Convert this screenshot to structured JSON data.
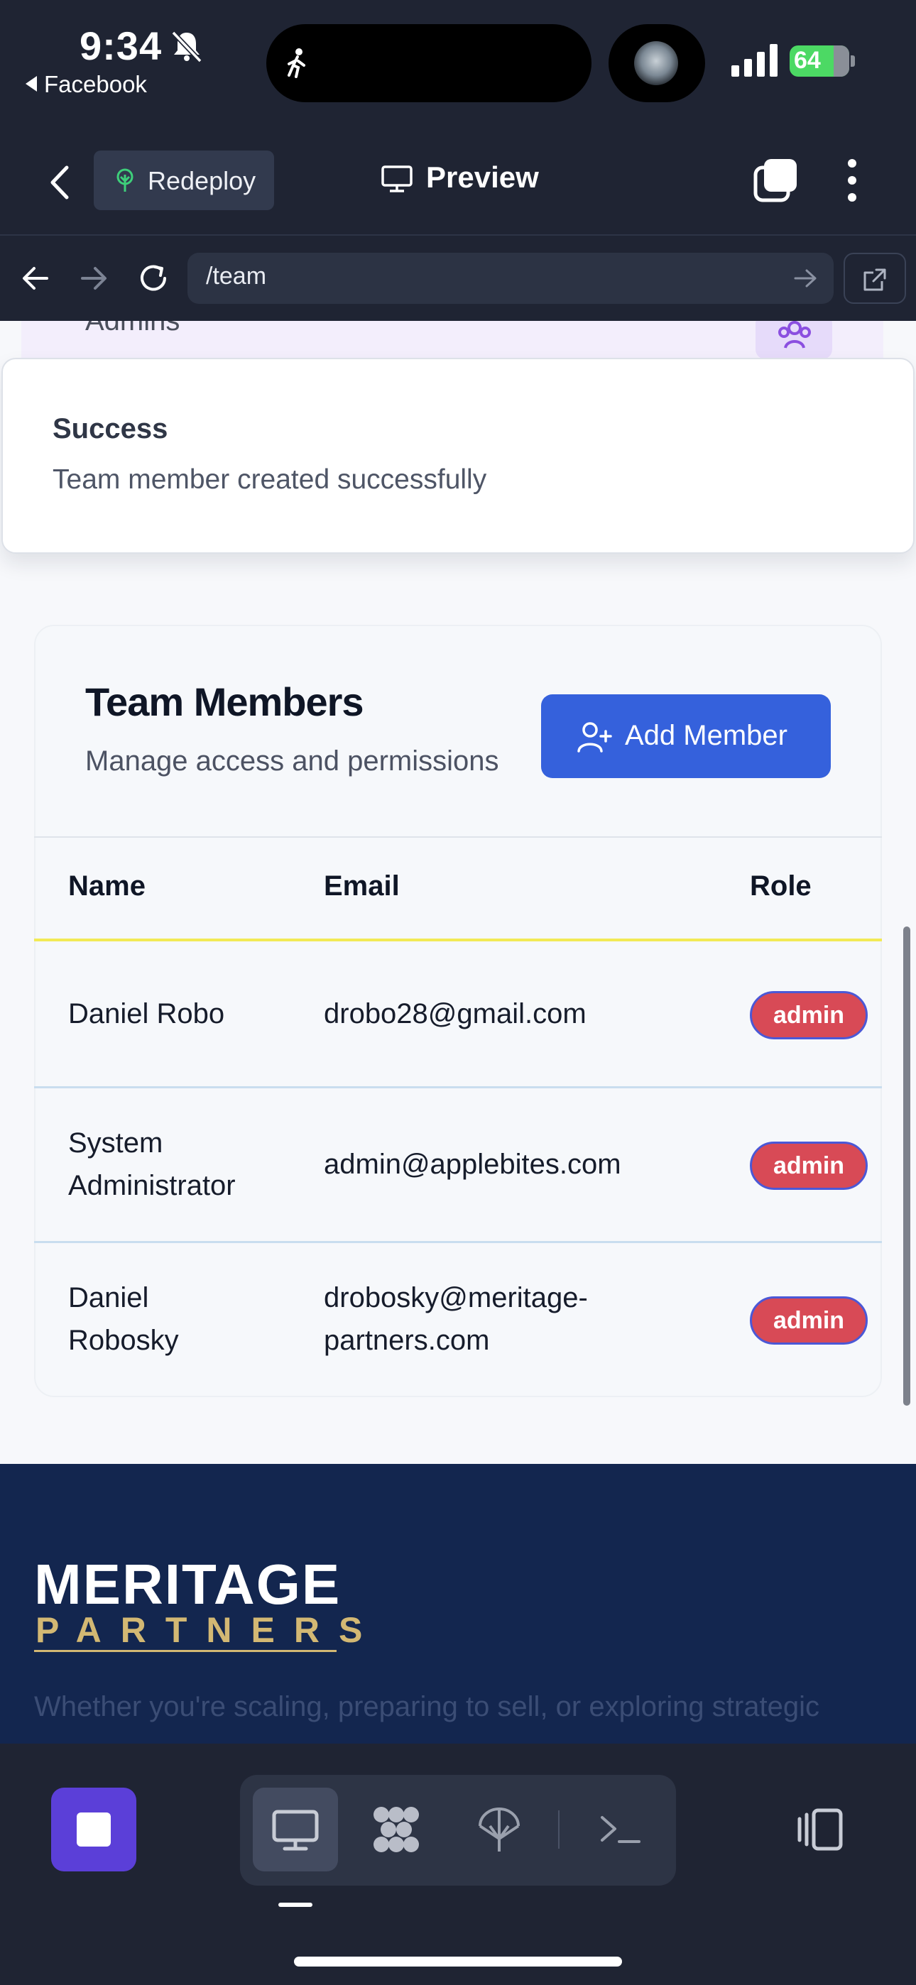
{
  "status_bar": {
    "time": "9:34",
    "back_app": "Facebook",
    "battery": "64"
  },
  "app_header": {
    "redeploy_label": "Redeploy",
    "preview_label": "Preview"
  },
  "url_bar": {
    "url": "/team"
  },
  "peek": {
    "section_label": "Admins"
  },
  "toast": {
    "title": "Success",
    "message": "Team member created successfully"
  },
  "team": {
    "title": "Team Members",
    "subtitle": "Manage access and permissions",
    "add_button": "Add Member",
    "columns": [
      "Name",
      "Email",
      "Role"
    ],
    "rows": [
      {
        "name": [
          "Daniel Robo"
        ],
        "email": [
          "drobo28@gmail.com"
        ],
        "role": "admin"
      },
      {
        "name": [
          "System",
          "Administrator"
        ],
        "email": [
          "admin@applebites.com"
        ],
        "role": "admin"
      },
      {
        "name": [
          "Daniel",
          "Robosky"
        ],
        "email": [
          "drobosky@meritage-",
          "partners.com"
        ],
        "role": "admin"
      }
    ]
  },
  "footer": {
    "logo_top": "MERITAGE",
    "logo_bottom": "PARTNERS",
    "tagline": "Whether you're scaling, preparing to sell, or exploring strategic"
  },
  "colors": {
    "chrome_bg": "#1f2433",
    "primary": "#3561dc",
    "badge_admin": "#d84a56",
    "footer_bg": "#13264f",
    "gold": "#d3b873"
  },
  "icons": {
    "bell": "bell-slash-icon",
    "redeploy": "tree-icon",
    "preview": "monitor-icon",
    "toolbar": [
      "stop-icon",
      "desktop-icon",
      "grid-icon",
      "network-icon",
      "terminal-icon",
      "split-view-icon"
    ]
  }
}
